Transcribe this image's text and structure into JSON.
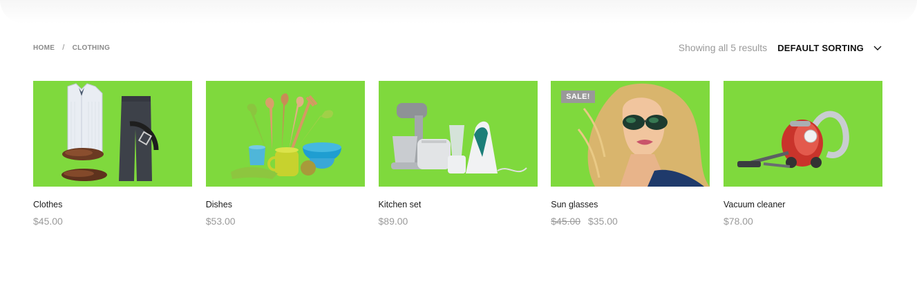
{
  "breadcrumb": {
    "home": "HOME",
    "separator": "/",
    "current": "CLOTHING"
  },
  "toolbar": {
    "result_count": "Showing all 5 results",
    "sorting_label": "DEFAULT SORTING",
    "sorting_icon": "chevron-down-icon"
  },
  "colors": {
    "thumb_bg": "#7fd93d",
    "sale_badge": "#999999",
    "price": "#9a9a9a"
  },
  "products": [
    {
      "title": "Clothes",
      "price": "$45.00",
      "image": "clothes-image"
    },
    {
      "title": "Dishes",
      "price": "$53.00",
      "image": "dishes-image"
    },
    {
      "title": "Kitchen set",
      "price": "$89.00",
      "image": "kitchen-set-image"
    },
    {
      "title": "Sun glasses",
      "old_price": "$45.00",
      "price": "$35.00",
      "badge": "SALE!",
      "image": "sun-glasses-image"
    },
    {
      "title": "Vacuum cleaner",
      "price": "$78.00",
      "image": "vacuum-cleaner-image"
    }
  ]
}
